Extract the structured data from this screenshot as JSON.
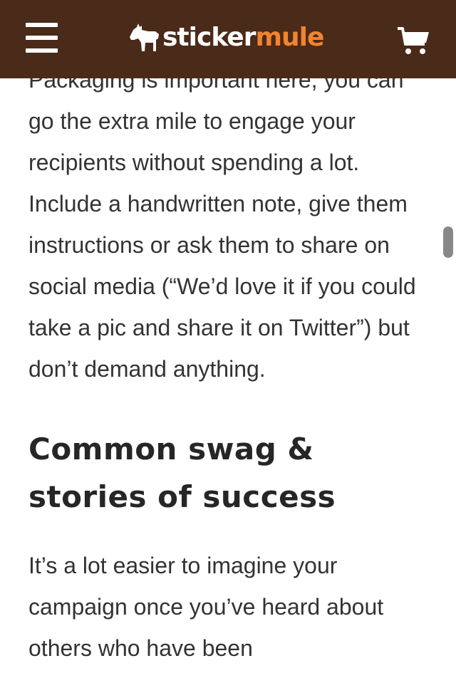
{
  "header": {
    "logo_part1": "sticker",
    "logo_part2": "mule",
    "colors": {
      "background": "#4a2a19",
      "accent": "#f2842e",
      "text": "#ffffff"
    },
    "icons": {
      "menu": "hamburger-menu-icon",
      "logo": "mule-icon",
      "cart": "shopping-cart-icon"
    }
  },
  "article": {
    "paragraph1": "Packaging is important here, you can go the extra mile to engage your recipients without spending a lot. Include a handwritten note, give them instructions or ask them to share on social media (“We’d love it if you could take a pic and share it on Twitter”) but don’t demand anything.",
    "heading": "Common swag & stories of success",
    "paragraph2": "It’s a lot easier to imagine your campaign once you’ve heard about others who have been"
  }
}
